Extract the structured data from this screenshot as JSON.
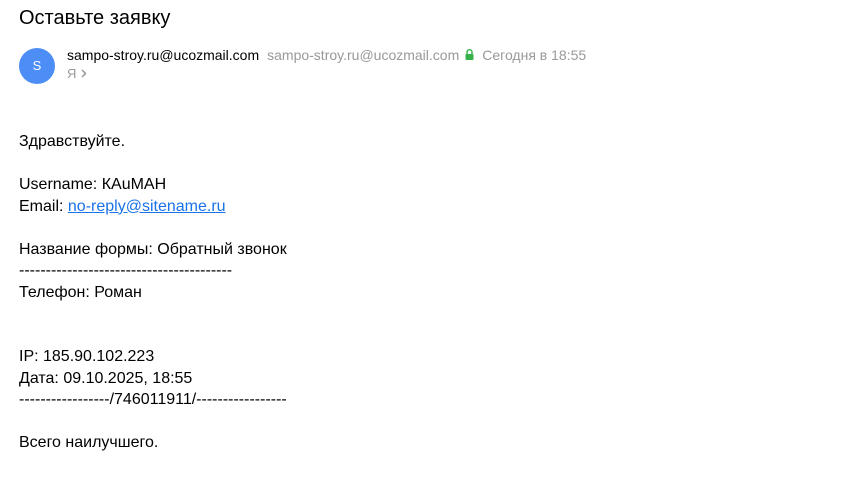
{
  "email": {
    "subject": "Оставьте заявку",
    "avatar_letter": "S",
    "avatar_color": "#4c8df6",
    "sender_name": "sampo-stroy.ru@ucozmail.com",
    "sender_address": "sampo-stroy.ru@ucozmail.com",
    "verified_icon": "lock-icon",
    "verified_color": "#35b34a",
    "date": "Сегодня в 18:55",
    "recipient": "Я",
    "expand_icon": "chevron-right-icon"
  },
  "body": {
    "greeting": "Здравствуйте.",
    "username": "Username: КАuМАН",
    "email_label": "Email: ",
    "email_link": "no-reply@sitename.ru",
    "form_name": "Название формы: Обратный звонок",
    "separator1": "----------------------------------------",
    "phone": "Телефон: Роман",
    "ip": "IP: 185.90.102.223",
    "date": "Дата: 09.10.2025, 18:55",
    "separator2": "-----------------/746011911/-----------------",
    "closing": "Всего наилучшего."
  },
  "colors": {
    "link": "#1a73e8",
    "muted": "#999999"
  }
}
